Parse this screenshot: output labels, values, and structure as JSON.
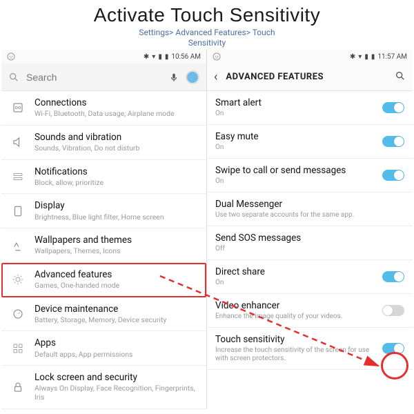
{
  "header": {
    "title": "Activate Touch Sensitivity",
    "breadcrumb_l1": "Settings> Advanced Features> Touch",
    "breadcrumb_l2": "Sensitivity"
  },
  "left": {
    "status_time": "10:56 AM",
    "search_placeholder": "Search",
    "items": [
      {
        "label": "Connections",
        "sub": "Wi-Fi, Bluetooth, Data usage, Airplane mode"
      },
      {
        "label": "Sounds and vibration",
        "sub": "Sounds, Vibration, Do not disturb"
      },
      {
        "label": "Notifications",
        "sub": "Block, allow, prioritize"
      },
      {
        "label": "Display",
        "sub": "Brightness, Blue light filter, Home screen"
      },
      {
        "label": "Wallpapers and themes",
        "sub": "Wallpapers, Themes, Icons"
      },
      {
        "label": "Advanced features",
        "sub": "Games, One-handed mode"
      },
      {
        "label": "Device maintenance",
        "sub": "Battery, Storage, Memory, Device security"
      },
      {
        "label": "Apps",
        "sub": "Default apps, App permissions"
      },
      {
        "label": "Lock screen and security",
        "sub": "Always On Display, Face Recognition, Fingerprints, Iris"
      }
    ]
  },
  "right": {
    "status_time": "11:57 AM",
    "title": "ADVANCED FEATURES",
    "items": [
      {
        "label": "Smart alert",
        "sub": "On",
        "toggle": "on"
      },
      {
        "label": "Easy mute",
        "sub": "On",
        "toggle": "on"
      },
      {
        "label": "Swipe to call or send messages",
        "sub": "On",
        "toggle": "on"
      },
      {
        "label": "Dual Messenger",
        "sub": "Use two separate accounts for the same app.",
        "toggle": null
      },
      {
        "label": "Send SOS messages",
        "sub": "Off",
        "toggle": null
      },
      {
        "label": "Direct share",
        "sub": "On",
        "toggle": "on"
      },
      {
        "label": "Video enhancer",
        "sub": "Enhance the image quality of your videos.",
        "toggle": "off"
      },
      {
        "label": "Touch sensitivity",
        "sub": "Increase the touch sensitivity of the screen for use with screen protectors.",
        "toggle": "on"
      }
    ]
  },
  "annotation": {
    "highlight_color": "#e52e2e"
  }
}
